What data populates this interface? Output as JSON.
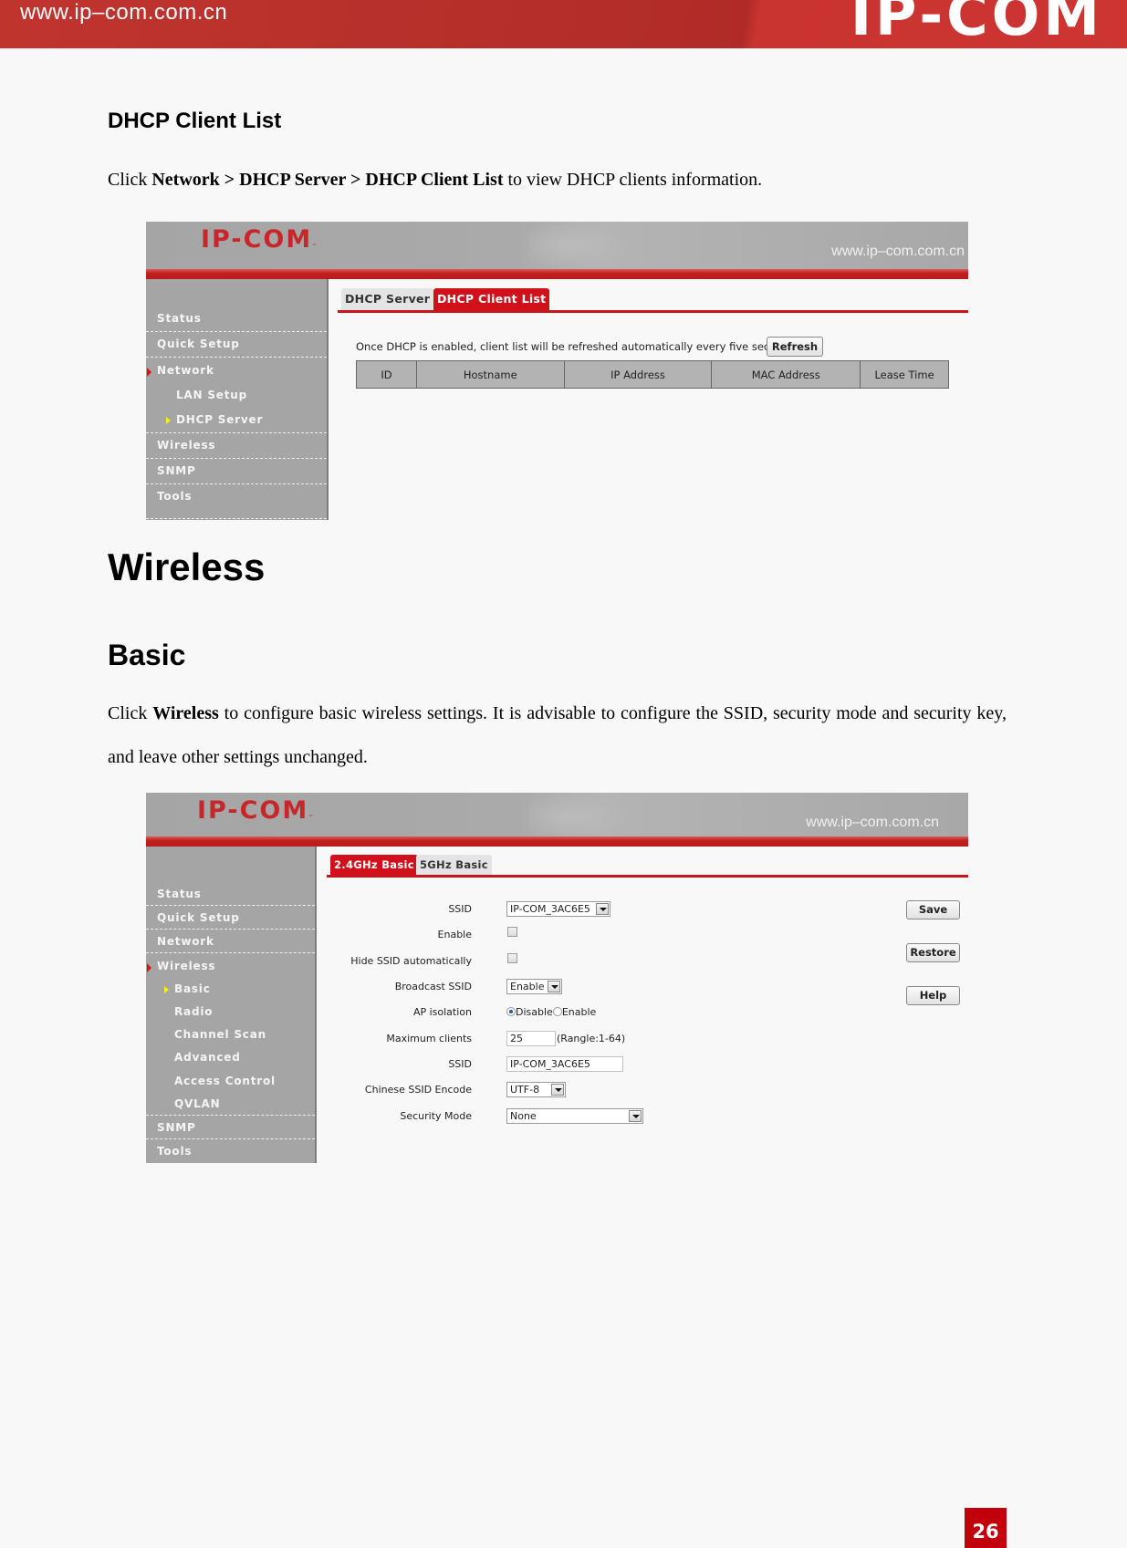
{
  "page_header": {
    "url": "www.ip–com.com.cn",
    "logo": "IP-COM"
  },
  "section_dhcp": {
    "heading": "DHCP Client List",
    "intro_prefix": "Click ",
    "intro_path": "Network > DHCP Server > DHCP Client List",
    "intro_suffix": " to view DHCP clients information."
  },
  "screenshot_dhcp": {
    "banner_logo": "IP-COM",
    "banner_url": "www.ip–com.com.cn",
    "sidebar": [
      {
        "label": "Status",
        "level": 0
      },
      {
        "label": "Quick Setup",
        "level": 0
      },
      {
        "label": "Network",
        "level": 0,
        "active": true
      },
      {
        "label": "LAN Setup",
        "level": 1
      },
      {
        "label": "DHCP Server",
        "level": 1,
        "active": true
      },
      {
        "label": "Wireless",
        "level": 0
      },
      {
        "label": "SNMP",
        "level": 0
      },
      {
        "label": "Tools",
        "level": 0
      }
    ],
    "tabs": [
      {
        "label": "DHCP Server",
        "active": false
      },
      {
        "label": "DHCP Client List",
        "active": true
      }
    ],
    "notice": "Once DHCP is enabled, client list will be refreshed automatically every five seconds.",
    "refresh_button": "Refresh",
    "table_headers": [
      "ID",
      "Hostname",
      "IP Address",
      "MAC Address",
      "Lease Time"
    ],
    "table_rows": []
  },
  "section_wireless": {
    "heading": "Wireless",
    "subheading": "Basic",
    "intro_prefix": "Click ",
    "intro_bold": "Wireless",
    "intro_suffix": " to configure basic wireless settings. It is advisable to configure the SSID, security mode and security key, and leave other settings unchanged."
  },
  "screenshot_wireless": {
    "banner_logo": "IP-COM",
    "banner_url": "www.ip–com.com.cn",
    "sidebar": [
      {
        "label": "Status",
        "level": 0
      },
      {
        "label": "Quick Setup",
        "level": 0
      },
      {
        "label": "Network",
        "level": 0
      },
      {
        "label": "Wireless",
        "level": 0,
        "active": true
      },
      {
        "label": "Basic",
        "level": 1,
        "active": true
      },
      {
        "label": "Radio",
        "level": 1
      },
      {
        "label": "Channel Scan",
        "level": 1
      },
      {
        "label": "Advanced",
        "level": 1
      },
      {
        "label": "Access Control",
        "level": 1
      },
      {
        "label": "QVLAN",
        "level": 1
      },
      {
        "label": "SNMP",
        "level": 0
      },
      {
        "label": "Tools",
        "level": 0
      }
    ],
    "tabs": [
      {
        "label": "2.4GHz Basic",
        "active": true
      },
      {
        "label": "5GHz Basic",
        "active": false
      }
    ],
    "form": {
      "ssid_select_label": "SSID",
      "ssid_select_value": "IP-COM_3AC6E5",
      "enable_label": "Enable",
      "enable_checked": false,
      "hide_ssid_label": "Hide SSID automatically",
      "hide_ssid_checked": false,
      "broadcast_label": "Broadcast SSID",
      "broadcast_value": "Enable",
      "ap_isolation_label": "AP isolation",
      "ap_isolation_options": [
        "Disable",
        "Enable"
      ],
      "ap_isolation_selected": "Disable",
      "max_clients_label": "Maximum clients",
      "max_clients_value": "25",
      "max_clients_hint": "(Rangle:1-64)",
      "ssid_text_label": "SSID",
      "ssid_text_value": "IP-COM_3AC6E5",
      "encode_label": "Chinese SSID Encode",
      "encode_value": "UTF-8",
      "security_label": "Security Mode",
      "security_value": "None"
    },
    "buttons": {
      "save": "Save",
      "restore": "Restore",
      "help": "Help"
    }
  },
  "footer": {
    "page_number": "26",
    "page_number_color": "#c2000b"
  },
  "colors": {
    "brand_red": "#c8141b",
    "sidebar_gray": "#a5a5a5"
  }
}
